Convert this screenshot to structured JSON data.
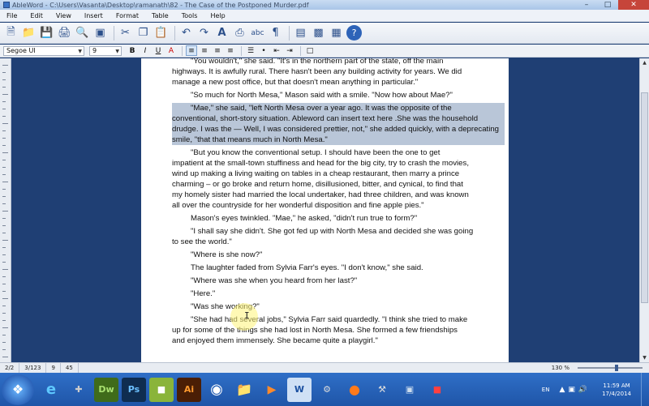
{
  "window": {
    "title": "AbleWord - C:\\Users\\Vasanta\\Desktop\\ramanath\\82 - The Case of the Postponed Murder.pdf"
  },
  "menu": [
    "File",
    "Edit",
    "View",
    "Insert",
    "Format",
    "Table",
    "Tools",
    "Help"
  ],
  "toolbar": {
    "icons": [
      "new-document",
      "open-folder",
      "save",
      "print",
      "print-preview",
      "image",
      "cut",
      "copy",
      "paste",
      "undo",
      "redo",
      "font",
      "find",
      "spell-check",
      "paragraph-mark",
      "show-hide",
      "insert-image",
      "table",
      "help"
    ]
  },
  "format": {
    "font": "Segoe UI",
    "size": "9",
    "buttons": [
      "B",
      "I",
      "U",
      "A"
    ]
  },
  "document": {
    "paragraphs": [
      {
        "lines": [
          "\"You wouldn't,\" she said. \"It's in the northern part of the state, off the main",
          "highways. It is awfully rural. There hasn't been any building activity for years. We did",
          "manage a new post office, but that doesn't mean anything in particular.\""
        ]
      },
      {
        "lines": [
          "\"So much for North Mesa,\" Mason said with a smile. \"Now how about Mae?\""
        ]
      },
      {
        "highlighted": true,
        "lines": [
          "\"Mae,\" she said, \"left North Mesa over a year ago. It was the opposite of the",
          "conventional, short-story situation. Ableword can insert text here .She was the household",
          "drudge. I was the — Well, I  was considered prettier, not,\" she added quickly, with a deprecating",
          "smile, \"that that  means much in North Mesa.\""
        ]
      },
      {
        "lines": [
          "\"But you know the conventional setup. I should have been the one to get",
          "impatient at the small-town stuffiness and head for the big city, try to crash the movies,",
          "wind up making a living waiting on tables in a cheap restaurant, then marry a prince",
          "charming – or go broke and return home, disillusioned, bitter, and cynical, to find that",
          "my homely sister had married the local undertaker, had three children, and was known",
          "all over the countryside for her wonderful disposition and fine apple pies.\""
        ]
      },
      {
        "lines": [
          "Mason's eyes twinkled. \"Mae,\" he asked, \"didn't run true to form?\""
        ]
      },
      {
        "lines": [
          "\"I shall say she didn't. She got fed up with North Mesa and decided she was going",
          "to see the world.\""
        ]
      },
      {
        "lines": [
          "\"Where is she now?\""
        ]
      },
      {
        "lines": [
          "The laughter faded from Sylvia Farr's eyes. \"I don't know,\" she said."
        ]
      },
      {
        "lines": [
          "\"Where was she when you heard from her last?\""
        ]
      },
      {
        "lines": [
          "\"Here.\""
        ]
      },
      {
        "lines": [
          "\"Was she working?\""
        ]
      },
      {
        "lines": [
          "\"She had had several jobs,\" Sylvia Farr said quardedly. \"I think she tried to make",
          "up for some of the things she had lost in North Mesa. She formed a few friendships",
          "and enjoyed them immensely. She became quite a playgirl.\""
        ]
      }
    ]
  },
  "status": {
    "page": "2/2",
    "section": "3/123",
    "line": "9",
    "col": "45",
    "zoom": "130 %"
  },
  "taskbar": {
    "apps": [
      "IE",
      "Tools",
      "Dw",
      "Ps",
      "Dr",
      "Ai",
      "Chrome",
      "Folder",
      "Media",
      "W",
      "FF",
      "Tool",
      "Win",
      "Red"
    ]
  },
  "tray": {
    "lang": "EN",
    "time": "11:59 AM",
    "date": "17/4/2014"
  }
}
